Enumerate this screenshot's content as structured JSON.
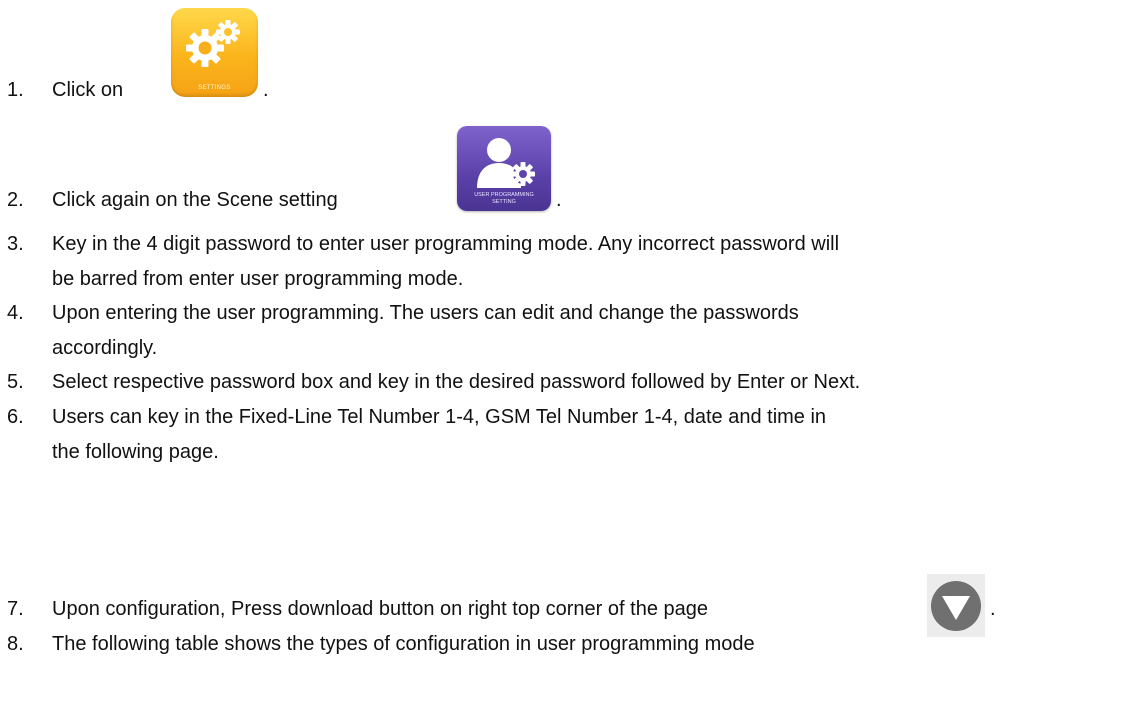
{
  "steps": [
    {
      "num": "1.",
      "text": "Click on",
      "after": "."
    },
    {
      "num": "2.",
      "text": "Click again on the Scene setting",
      "after": "."
    },
    {
      "num": "3.",
      "line1": "Key in the 4 digit password to enter user programming mode.  Any incorrect password will",
      "line2": "be barred from enter user programming mode."
    },
    {
      "num": "4.",
      "line1": "Upon entering the user programming.  The users can edit and change the passwords",
      "line2": "accordingly."
    },
    {
      "num": "5.",
      "text": "Select respective password box and key in the desired password followed by Enter or Next."
    },
    {
      "num": "6.",
      "line1": "Users can key in the Fixed-Line Tel Number 1-4, GSM Tel Number 1-4, date and time in",
      "line2": "the following page."
    },
    {
      "num": "7.",
      "text": "Upon configuration, Press download button on right top corner of the page",
      "after": "."
    },
    {
      "num": "8.",
      "text": "The following table shows the types of configuration in user programming mode"
    }
  ],
  "icons": {
    "settings_label": "SETTINGS",
    "user_programming_label_1": "USER PROGRAMMING",
    "user_programming_label_2": "SETTING"
  },
  "colors": {
    "settings_icon": "#fbb41c",
    "user_programming_icon": "#5a41a8",
    "download_icon": "#6f6f6f"
  }
}
